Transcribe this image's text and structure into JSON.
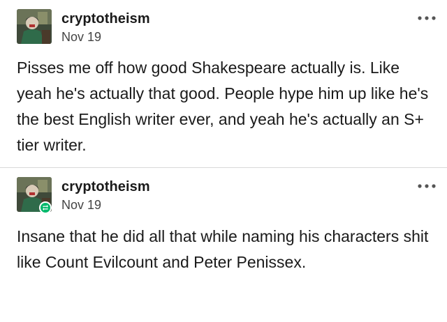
{
  "posts": [
    {
      "username": "cryptotheism",
      "date": "Nov 19",
      "text": "Pisses me off how good Shakespeare actually is. Like yeah he's actually that good. People hype him up like he's the best English writer ever, and yeah he's actually an S+ tier writer.",
      "avatar_icon": "user-avatar",
      "menu_icon": "more-options-icon"
    },
    {
      "username": "cryptotheism",
      "date": "Nov 19",
      "text": "Insane that he did all that while naming his characters shit like Count Evilcount and Peter Penissex.",
      "avatar_icon": "user-avatar",
      "badge_icon": "reblog-icon",
      "badge_color": "#00b86b",
      "menu_icon": "more-options-icon"
    }
  ]
}
